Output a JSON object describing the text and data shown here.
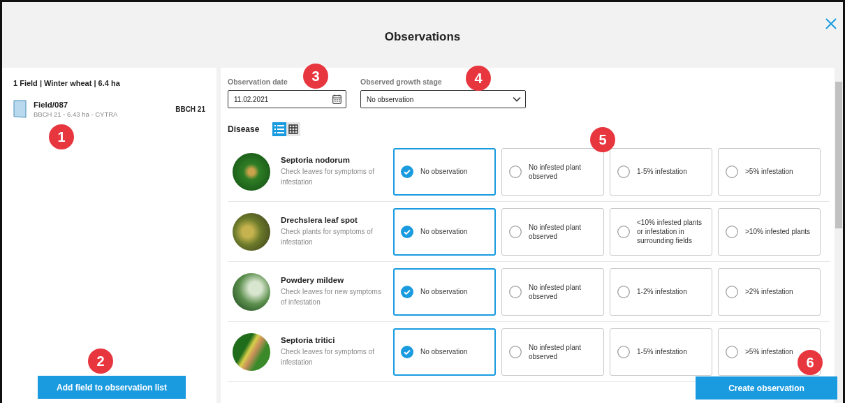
{
  "window": {
    "title": "Observations"
  },
  "field_panel": {
    "summary": "1 Field | Winter wheat | 6.4 ha",
    "fields": [
      {
        "name": "Field/087",
        "details": "BBCH 21 - 6.43 ha - CYTRA",
        "stage": "BBCH 21"
      }
    ],
    "add_button": "Add field to observation list"
  },
  "form": {
    "date": {
      "label": "Observation date",
      "value": "11.02.2021"
    },
    "growth_stage": {
      "label": "Observed growth stage",
      "value": "No observation"
    }
  },
  "disease_section": {
    "title": "Disease",
    "view_toggle": [
      {
        "kind": "list",
        "selected": true
      },
      {
        "kind": "grid",
        "selected": false
      }
    ],
    "diseases": [
      {
        "name": "Septoria nodorum",
        "hint": "Check leaves for symptoms of infestation",
        "options": [
          {
            "label": "No observation",
            "selected": true
          },
          {
            "label": "No infested plant observed",
            "selected": false
          },
          {
            "label": "1-5% infestation",
            "selected": false
          },
          {
            "label": ">5% infestation",
            "selected": false
          }
        ]
      },
      {
        "name": "Drechslera leaf spot",
        "hint": "Check plants for symptoms of infestation",
        "options": [
          {
            "label": "No observation",
            "selected": true
          },
          {
            "label": "No infested plant observed",
            "selected": false
          },
          {
            "label": "<10% infested plants or infestation in surrounding fields",
            "selected": false
          },
          {
            "label": ">10% infested plants",
            "selected": false
          }
        ]
      },
      {
        "name": "Powdery mildew",
        "hint": "Check leaves for new symptoms of infestation",
        "options": [
          {
            "label": "No observation",
            "selected": true
          },
          {
            "label": "No infested plant observed",
            "selected": false
          },
          {
            "label": "1-2% infestation",
            "selected": false
          },
          {
            "label": ">2% infestation",
            "selected": false
          }
        ]
      },
      {
        "name": "Septoria tritici",
        "hint": "Check leaves for symptoms of infestation",
        "options": [
          {
            "label": "No observation",
            "selected": true
          },
          {
            "label": "No infested plant observed",
            "selected": false
          },
          {
            "label": "1-5% infestation",
            "selected": false
          },
          {
            "label": ">5% infestation",
            "selected": false
          }
        ]
      }
    ]
  },
  "create_button": "Create observation",
  "callouts": [
    {
      "label": "1"
    },
    {
      "label": "2"
    },
    {
      "label": "3"
    },
    {
      "label": "4"
    },
    {
      "label": "5"
    },
    {
      "label": "6"
    }
  ]
}
